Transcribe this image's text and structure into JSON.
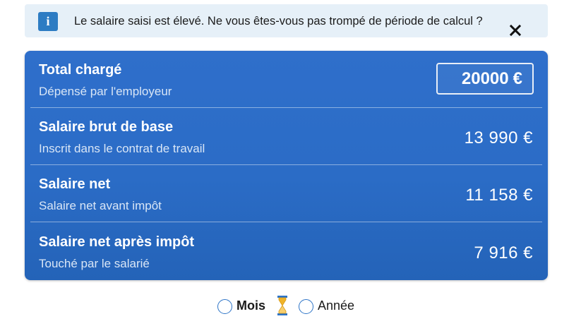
{
  "alert": {
    "info_icon": "info-icon",
    "message": "Le salaire saisi est élevé. Ne vous êtes-vous pas trompé de période de calcul ?",
    "close_icon": "close-icon"
  },
  "rows": [
    {
      "title": "Total chargé",
      "subtitle": "Dépensé par l'employeur",
      "input_value": "20000",
      "currency": "€"
    },
    {
      "title": "Salaire brut de base",
      "subtitle": "Inscrit dans le contrat de travail",
      "value": "13 990 €"
    },
    {
      "title": "Salaire net",
      "subtitle": "Salaire net avant impôt",
      "value": "11 158 €"
    },
    {
      "title": "Salaire net après impôt",
      "subtitle": "Touché par le salarié",
      "value": "7 916 €"
    }
  ],
  "period": {
    "options": [
      {
        "label": "Mois",
        "selected": false
      },
      {
        "label": "Année",
        "selected": false
      }
    ],
    "loading_icon": "hourglass-icon"
  },
  "colors": {
    "panel": "#2b6cc6",
    "alert_bg": "#e6f0f8",
    "info_icon": "#2d7cc3",
    "hourglass_accent": "#f0b429"
  }
}
